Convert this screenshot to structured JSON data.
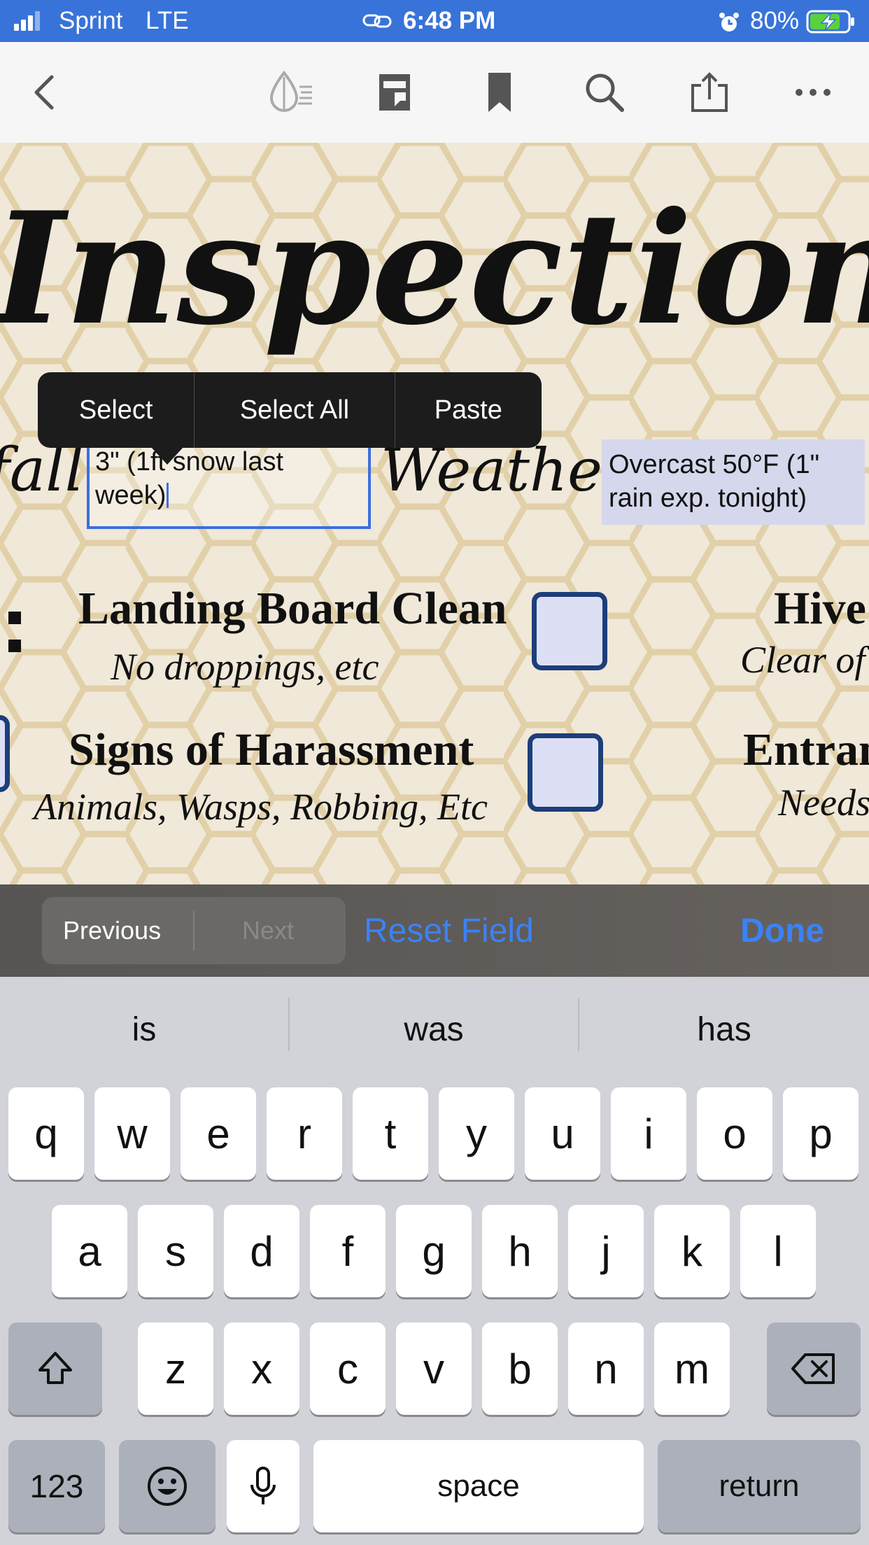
{
  "status_bar": {
    "carrier": "Sprint",
    "network": "LTE",
    "time": "6:48 PM",
    "battery_percent": "80%",
    "battery_level": 0.8,
    "signal_bars_filled": 3,
    "icons": [
      "signal-icon",
      "link-icon",
      "alarm-icon",
      "battery-charging-icon"
    ]
  },
  "toolbar": {
    "icons": [
      "back-chevron-icon",
      "reader-mode-icon",
      "pages-icon",
      "bookmark-icon",
      "search-icon",
      "share-icon",
      "more-icon"
    ]
  },
  "document": {
    "title": "Inspection Che",
    "rainfall_label": "fall",
    "rainfall_value_line1": "3\" (1ft snow last",
    "rainfall_value_line2": "week)",
    "weather_label": "Weather",
    "weather_value_line1": "Overcast  50°F (1\"",
    "weather_value_line2": "rain exp. tonight)",
    "rows": [
      {
        "title": "Landing Board Clean",
        "subtitle": "No droppings, etc",
        "right_title": "Hive",
        "right_subtitle": "Clear of"
      },
      {
        "title": "Signs of Harassment",
        "subtitle": "Animals, Wasps, Robbing, Etc",
        "right_title": "Entran",
        "right_subtitle": "Needs"
      }
    ]
  },
  "context_menu": {
    "items": [
      "Select",
      "Select All",
      "Paste"
    ]
  },
  "form_bar": {
    "previous": "Previous",
    "next": "Next",
    "reset": "Reset Field",
    "done": "Done",
    "accent": "#3b82f6"
  },
  "keyboard": {
    "suggestions": [
      "is",
      "was",
      "has"
    ],
    "row1": [
      "q",
      "w",
      "e",
      "r",
      "t",
      "y",
      "u",
      "i",
      "o",
      "p"
    ],
    "row2": [
      "a",
      "s",
      "d",
      "f",
      "g",
      "h",
      "j",
      "k",
      "l"
    ],
    "row3": [
      "z",
      "x",
      "c",
      "v",
      "b",
      "n",
      "m"
    ],
    "numbers_key": "123",
    "space_key": "space",
    "return_key": "return",
    "icons": [
      "shift-icon",
      "delete-icon",
      "emoji-icon",
      "microphone-icon"
    ]
  }
}
